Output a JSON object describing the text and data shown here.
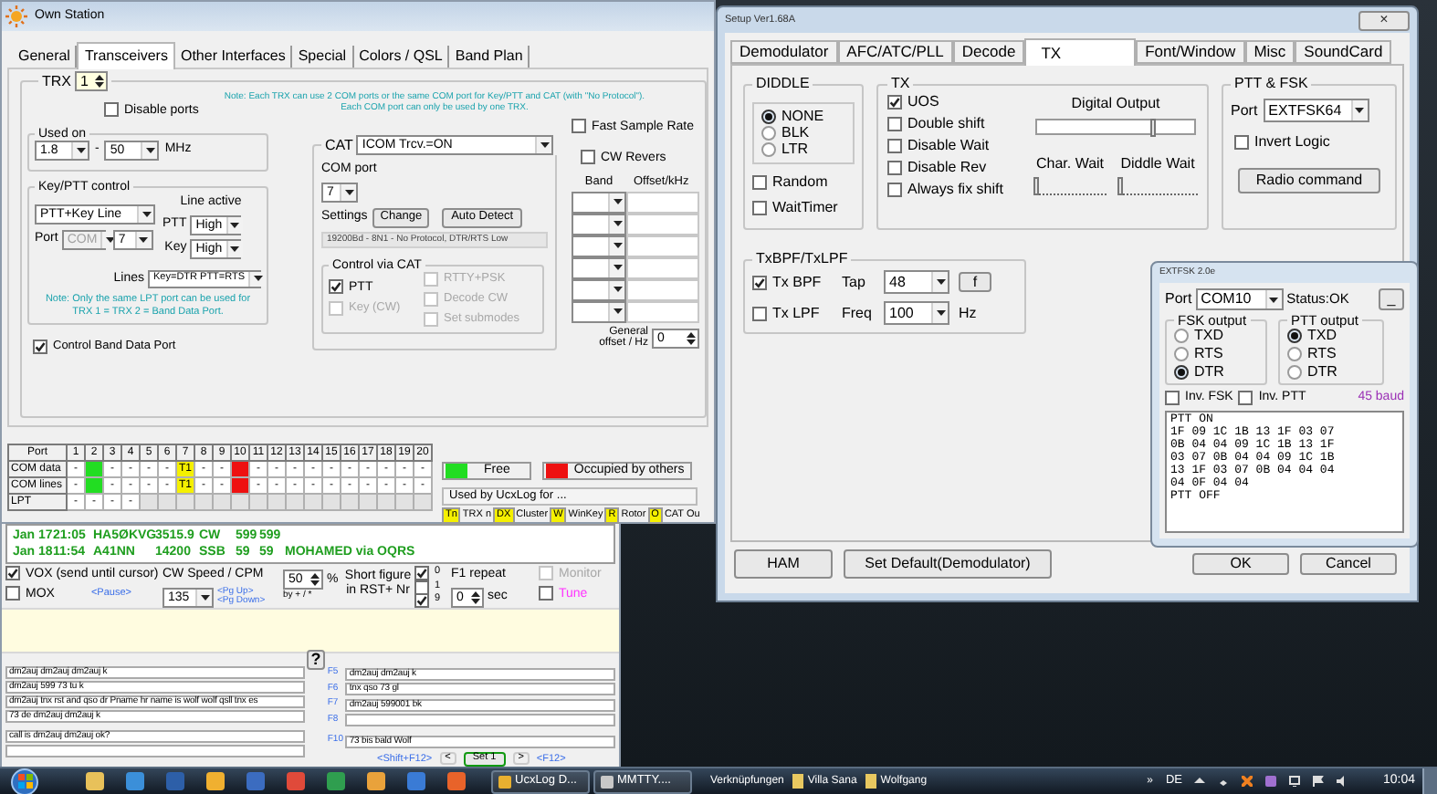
{
  "own_station": {
    "title": "Own Station",
    "tabs": [
      {
        "label": "General",
        "selected": false
      },
      {
        "label": "Transceivers",
        "selected": true
      },
      {
        "label": "Other Interfaces",
        "selected": false
      },
      {
        "label": "Special",
        "selected": false
      },
      {
        "label": "Colors / QSL",
        "selected": false
      },
      {
        "label": "Band Plan",
        "selected": false
      }
    ],
    "trx": {
      "label": "TRX",
      "value": "1"
    },
    "disable_ports": {
      "label": "Disable ports",
      "checked": false
    },
    "note": [
      "Note: Each TRX can use 2 COM ports or the same COM port for Key/PTT and CAT (with \"No Protocol\").",
      "Each COM port can only be used by one TRX."
    ],
    "used_on": {
      "label": "Used on",
      "from": "1.8",
      "separator": "-",
      "to": "50",
      "unit": "MHz"
    },
    "key_ptt": {
      "label": "Key/PTT control",
      "mode": "PTT+Key Line",
      "port_label": "Port",
      "port_type": {
        "value": "COM",
        "disabled": true
      },
      "port": "7",
      "line_active": "Line active",
      "ptt_label": "PTT",
      "ptt": "High",
      "key_label": "Key",
      "key": "High",
      "lines_label": "Lines",
      "lines": "Key=DTR PTT=RTS",
      "note": [
        "Note: Only the same LPT port can be used for",
        "TRX 1 = TRX 2 = Band Data Port."
      ]
    },
    "control_band_data_port": {
      "label": "Control Band Data Port",
      "checked": true
    },
    "cat": {
      "label": "CAT",
      "value": "ICOM Trcv.=ON",
      "com_port_label": "COM port",
      "com_port": "7",
      "settings_label": "Settings",
      "change": "Change",
      "auto_detect": "Auto Detect",
      "settings_value": "19200Bd - 8N1 - No Protocol, DTR/RTS Low",
      "control_label": "Control via CAT",
      "options": [
        {
          "label": "PTT",
          "checked": true,
          "disabled": false
        },
        {
          "label": "Key (CW)",
          "checked": false,
          "disabled": true
        },
        {
          "label": "RTTY+PSK",
          "checked": false,
          "disabled": true
        },
        {
          "label": "Decode CW",
          "checked": false,
          "disabled": true
        },
        {
          "label": "Set submodes",
          "checked": false,
          "disabled": true
        }
      ]
    },
    "fast_sample_rate": {
      "label": "Fast Sample Rate",
      "checked": false
    },
    "cw_revers": {
      "label": "CW Revers",
      "checked": false
    },
    "band_columns": [
      "Band",
      "Offset/kHz"
    ],
    "general_offset": {
      "label": [
        "General",
        "offset / Hz"
      ],
      "value": "0"
    },
    "port_table": {
      "columns": [
        "Port",
        "1",
        "2",
        "3",
        "4",
        "5",
        "6",
        "7",
        "8",
        "9",
        "10",
        "11",
        "12",
        "13",
        "14",
        "15",
        "16",
        "17",
        "18",
        "19",
        "20"
      ],
      "rows": [
        [
          "COM data",
          "-",
          {
            "color": "#22dd22"
          },
          "-",
          "-",
          "-",
          "-",
          {
            "text": "T1",
            "color": "#f5f000"
          },
          "-",
          "-",
          {
            "color": "#ee1111"
          },
          "-",
          "-",
          "-",
          "-",
          "-",
          "-",
          "-",
          "-",
          "-",
          "-"
        ],
        [
          "COM lines",
          "-",
          {
            "color": "#22dd22"
          },
          "-",
          "-",
          "-",
          "-",
          {
            "text": "T1",
            "color": "#f5f000"
          },
          "-",
          "-",
          {
            "color": "#ee1111"
          },
          "-",
          "-",
          "-",
          "-",
          "-",
          "-",
          "-",
          "-",
          "-",
          "-"
        ],
        [
          "LPT",
          "-",
          "-",
          "-",
          "-",
          "",
          "",
          "",
          "",
          "",
          "",
          "",
          "",
          "",
          "",
          "",
          "",
          "",
          "",
          "",
          ""
        ]
      ]
    },
    "legend": [
      {
        "label": "Free",
        "color": "#22dd22"
      },
      {
        "label": "Occupied by others",
        "color": "#ee1111"
      }
    ],
    "used_by": {
      "label": "Used by UcxLog for ...",
      "items": [
        {
          "code": "Tn",
          "label": "TRX n"
        },
        {
          "code": "DX",
          "label": "Cluster"
        },
        {
          "code": "W",
          "label": "WinKey"
        },
        {
          "code": "R",
          "label": "Rotor"
        },
        {
          "code": "O",
          "label": "CAT Ou"
        }
      ]
    }
  },
  "ucxlog": {
    "log": [
      {
        "date": "Jan 17",
        "time": "21:05",
        "call": "HA5ØKVG",
        "freq": "3515.9",
        "mode": "CW",
        "rst_sent": "599",
        "rst_rcvd": "599"
      },
      {
        "date": "Jan 18",
        "time": "11:54",
        "call": "A41NN",
        "freq": "14200",
        "mode": "SSB",
        "rst_sent": "59",
        "rst_rcvd": "59",
        "comment": "MOHAMED via OQRS"
      }
    ],
    "vox": {
      "label": "VOX (send until cursor)",
      "checked": true
    },
    "pause": "<Pause>",
    "mox": {
      "label": "MOX",
      "checked": false
    },
    "cw_speed": {
      "label": "CW Speed / CPM",
      "value": "135",
      "up": "<Pg Up>",
      "down": "<Pg Down>"
    },
    "weight": {
      "value": "50",
      "unit": "%",
      "hint": "by + / *"
    },
    "short_figure": {
      "label": [
        "Short figure",
        "in RST+ Nr"
      ],
      "options": [
        {
          "label": "0",
          "checked": true
        },
        {
          "label": "1",
          "checked": false
        },
        {
          "label": "9",
          "checked": true
        }
      ]
    },
    "f1_repeat": {
      "label": "F1 repeat",
      "value": "0",
      "unit": "sec"
    },
    "monitor": {
      "label": "Monitor",
      "checked": false,
      "disabled": true
    },
    "tune": {
      "label": "Tune",
      "checked": false
    },
    "help": "?",
    "macros_left": {
      "upper": [
        "dm2auj dm2auj dm2auj  k",
        "dm2auj 599 73 tu k",
        "dm2auj tnx rst and qso dr Pname hr name is wolf wolf qsll tnx es",
        "73 de  dm2auj dm2auj k"
      ],
      "lower": [
        "call is dm2auj dm2auj ok?"
      ]
    },
    "macros_right": {
      "upper": [
        {
          "key": "F5",
          "text": "dm2auj dm2auj k"
        },
        {
          "key": "F6",
          "text": "tnx qso 73 gl"
        },
        {
          "key": "F7",
          "text": "dm2auj 599001  bk"
        },
        {
          "key": "F8"
        }
      ],
      "lower": [
        {
          "key": "F10",
          "text": "73 bis bald Wolf"
        }
      ]
    },
    "sets": {
      "prev_key": "<Shift+F12>",
      "prev": "<",
      "current": "Set 1",
      "next": ">",
      "next_key": "<F12>"
    }
  },
  "mmtty_setup": {
    "title": "Setup Ver1.68A",
    "close": "×",
    "tabs": [
      {
        "label": "Demodulator",
        "selected": false
      },
      {
        "label": "AFC/ATC/PLL",
        "selected": false
      },
      {
        "label": "Decode",
        "selected": false
      },
      {
        "label": "TX",
        "selected": true
      },
      {
        "label": "Font/Window",
        "selected": false
      },
      {
        "label": "Misc",
        "selected": false
      },
      {
        "label": "SoundCard",
        "selected": false
      }
    ],
    "diddle": {
      "label": "DIDDLE",
      "options": [
        {
          "label": "NONE",
          "selected": true
        },
        {
          "label": "BLK",
          "selected": false
        },
        {
          "label": "LTR",
          "selected": false
        }
      ],
      "random": {
        "label": "Random",
        "checked": false
      },
      "wait_timer": {
        "label": "WaitTimer",
        "checked": false
      }
    },
    "tx": {
      "label": "TX",
      "options": [
        {
          "label": "UOS",
          "checked": true
        },
        {
          "label": "Double shift",
          "checked": false
        },
        {
          "label": "Disable Wait",
          "checked": false
        },
        {
          "label": "Disable Rev",
          "checked": false
        },
        {
          "label": "Always fix shift",
          "checked": false
        }
      ],
      "digital_output": {
        "label": "Digital Output",
        "level": 0.75
      },
      "char_wait": {
        "label": "Char. Wait",
        "level": 0
      },
      "diddle_wait": {
        "label": "Diddle Wait",
        "level": 0
      }
    },
    "ptt_fsk": {
      "label": "PTT & FSK",
      "port_label": "Port",
      "port": "EXTFSK64",
      "invert_logic": {
        "label": "Invert Logic",
        "checked": false
      },
      "radio_command": "Radio command"
    },
    "txbpf": {
      "label": "TxBPF/TxLPF",
      "tx_bpf": {
        "label": "Tx BPF",
        "checked": true
      },
      "tap_label": "Tap",
      "tap": "48",
      "f_button": "f",
      "tx_lpf": {
        "label": "Tx LPF",
        "checked": false
      },
      "freq_label": "Freq",
      "freq": "100",
      "unit": "Hz"
    },
    "buttons": [
      "HAM",
      "Set Default(Demodulator)",
      "OK",
      "Cancel"
    ]
  },
  "extfsk": {
    "title": "EXTFSK 2.0e",
    "port_label": "Port",
    "port": "COM10",
    "status": "Status:OK",
    "minimize": "_",
    "fsk_output": {
      "label": "FSK output",
      "options": [
        {
          "label": "TXD",
          "selected": false
        },
        {
          "label": "RTS",
          "selected": false
        },
        {
          "label": "DTR",
          "selected": true
        }
      ]
    },
    "ptt_output": {
      "label": "PTT output",
      "options": [
        {
          "label": "TXD",
          "selected": true
        },
        {
          "label": "RTS",
          "selected": false
        },
        {
          "label": "DTR",
          "selected": false
        }
      ]
    },
    "inv_fsk": {
      "label": "Inv. FSK",
      "checked": false
    },
    "inv_ptt": {
      "label": "Inv. PTT",
      "checked": false
    },
    "baud": "45 baud",
    "log": [
      "PTT ON",
      "1F 09 1C 1B 13 1F 03 07",
      "0B 04 04 09 1C 1B 13 1F",
      "03 07 0B 04 04 09 1C 1B",
      "13 1F 03 07 0B 04 04 04",
      "04 0F 04 04",
      "PTT OFF"
    ]
  },
  "taskbar": {
    "buttons": [
      {
        "label": "UcxLog D..."
      },
      {
        "label": "MMTTY...."
      }
    ],
    "links": [
      {
        "label": "Verknüpfungen",
        "kind": "toolbar"
      },
      {
        "label": "Villa Sana",
        "kind": "folder"
      },
      {
        "label": "Wolfgang",
        "kind": "folder"
      }
    ],
    "overflow": "»",
    "language": "DE",
    "clock": "10:04"
  }
}
